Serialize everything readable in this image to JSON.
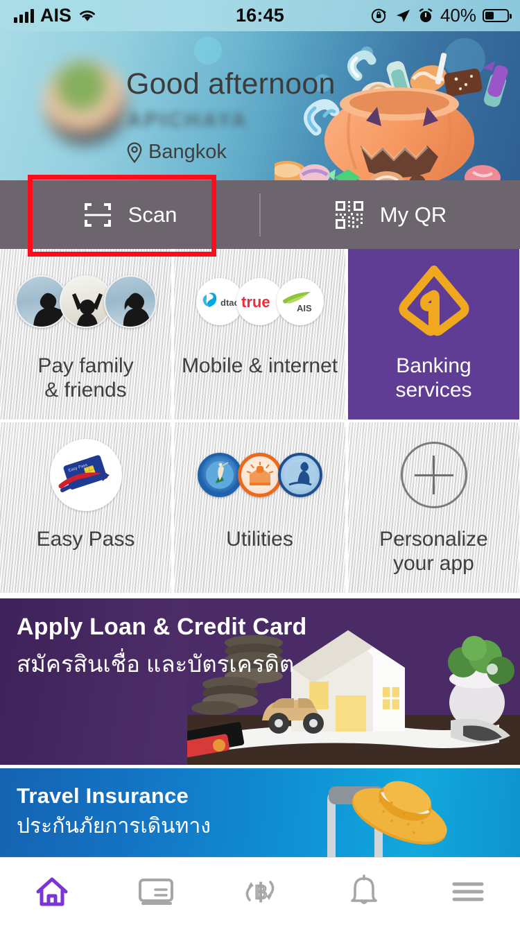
{
  "status_bar": {
    "carrier": "AIS",
    "time": "16:45",
    "battery_percent": "40%",
    "icons": [
      "signal-bars-icon",
      "wifi-icon",
      "rotation-lock-icon",
      "location-arrow-icon",
      "alarm-clock-icon",
      "battery-icon"
    ]
  },
  "header": {
    "greeting": "Good afternoon",
    "username": "APICHAYA",
    "location": "Bangkok",
    "location_icon": "map-pin-icon",
    "artwork": "halloween-pumpkin-candy-illustration"
  },
  "annotation": {
    "type": "red-highlight-rectangle",
    "color": "#fc0d1b",
    "targets": "scan-button"
  },
  "quick_actions": {
    "scan": {
      "label": "Scan",
      "icon": "scan-frame-icon"
    },
    "my_qr": {
      "label": "My QR",
      "icon": "qr-code-icon"
    },
    "bar_color": "#6d656e"
  },
  "tiles": [
    {
      "label": "Pay family\n& friends",
      "line1": "Pay family",
      "line2": "& friends",
      "icon": "people-photos-icon",
      "style": "light"
    },
    {
      "label": "Mobile & internet",
      "line1": "Mobile & internet",
      "line2": "",
      "icon": "telecom-logos-icon",
      "logos": [
        "dtac",
        "true",
        "AIS"
      ],
      "style": "light"
    },
    {
      "label": "Banking\nservices",
      "line1": "Banking",
      "line2": "services",
      "icon": "scb-shield-logo-icon",
      "style": "purple",
      "bg_color": "#603d95"
    },
    {
      "label": "Easy Pass",
      "line1": "Easy Pass",
      "line2": "",
      "icon": "easy-pass-card-icon",
      "style": "light"
    },
    {
      "label": "Utilities",
      "line1": "Utilities",
      "line2": "",
      "icon": "utility-seals-icon",
      "style": "light"
    },
    {
      "label": "Personalize\nyour app",
      "line1": "Personalize",
      "line2": "your app",
      "icon": "plus-circle-icon",
      "style": "light"
    }
  ],
  "banners": [
    {
      "title": "Apply Loan & Credit Card",
      "subtitle": "สมัครสินเชื่อ และบัตรเครดิต",
      "bg_color": "#4a2b66",
      "artwork": "model-house-toy-car-coins-photo"
    },
    {
      "title": "Travel Insurance",
      "subtitle": "ประกันภัยการเดินทาง",
      "bg_color": "#0f8fd4",
      "artwork": "straw-hat-luggage-photo"
    }
  ],
  "bottom_nav": {
    "active_color": "#7b35d6",
    "inactive_color": "#a6a6a6",
    "items": [
      {
        "name": "home",
        "icon": "home-icon",
        "active": true
      },
      {
        "name": "accounts",
        "icon": "card-book-icon",
        "active": false
      },
      {
        "name": "transfer",
        "icon": "baht-transfer-icon",
        "active": false
      },
      {
        "name": "notifications",
        "icon": "bell-icon",
        "active": false
      },
      {
        "name": "menu",
        "icon": "hamburger-menu-icon",
        "active": false
      }
    ]
  }
}
